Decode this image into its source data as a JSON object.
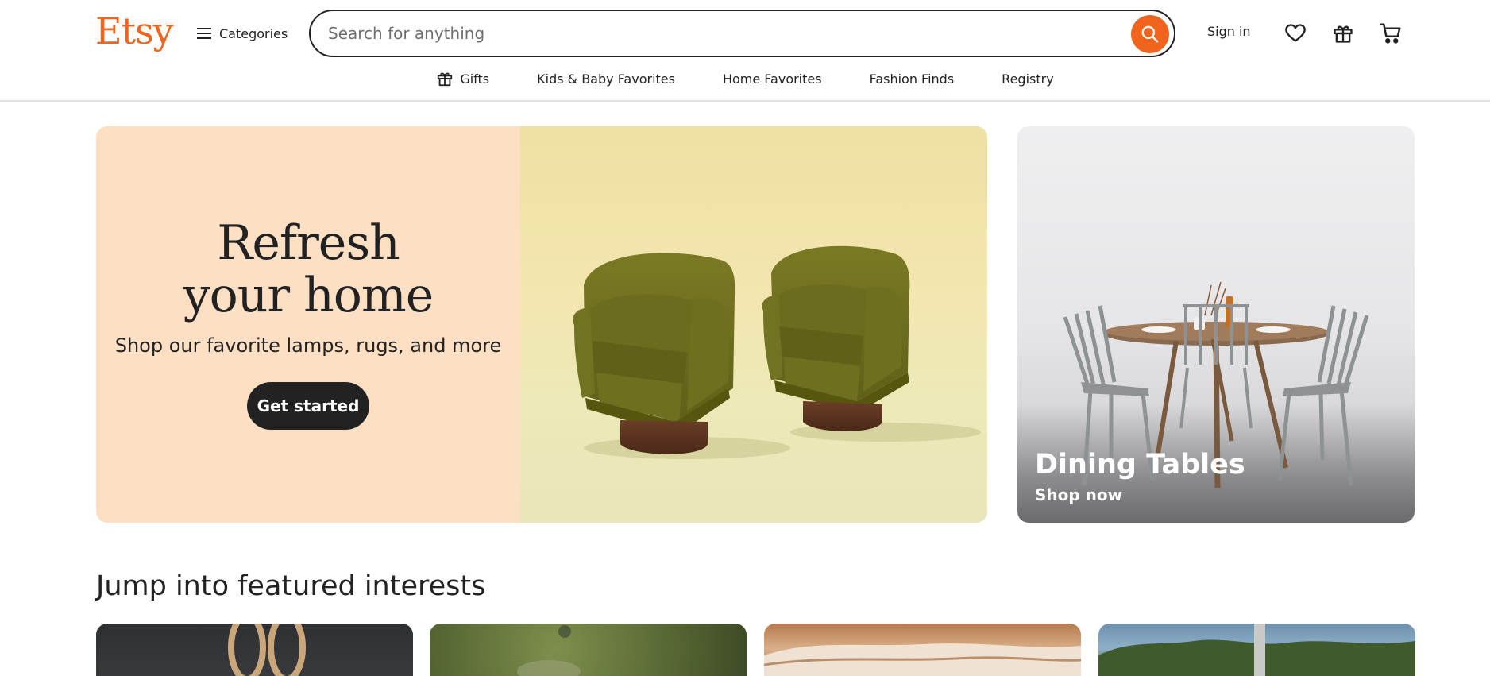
{
  "header": {
    "logo": "Etsy",
    "categories_label": "Categories",
    "search": {
      "placeholder": "Search for anything"
    },
    "signin_label": "Sign in",
    "icons": [
      "search-icon",
      "heart-icon",
      "gift-icon",
      "cart-icon"
    ]
  },
  "subnav": {
    "items": [
      {
        "label": "Gifts",
        "icon": "gift-icon"
      },
      {
        "label": "Kids & Baby Favorites"
      },
      {
        "label": "Home Favorites"
      },
      {
        "label": "Fashion Finds"
      },
      {
        "label": "Registry"
      }
    ]
  },
  "hero": {
    "title_line1": "Refresh",
    "title_line2": "your home",
    "subtitle": "Shop our favorite lamps, rugs, and more",
    "cta": "Get started",
    "bg_color": "#fddfc3"
  },
  "side_card": {
    "title": "Dining Tables",
    "link": "Shop now"
  },
  "featured": {
    "heading": "Jump into featured interests"
  },
  "colors": {
    "brand": "#f1641e",
    "text": "#222222",
    "button_dark": "#222222"
  }
}
